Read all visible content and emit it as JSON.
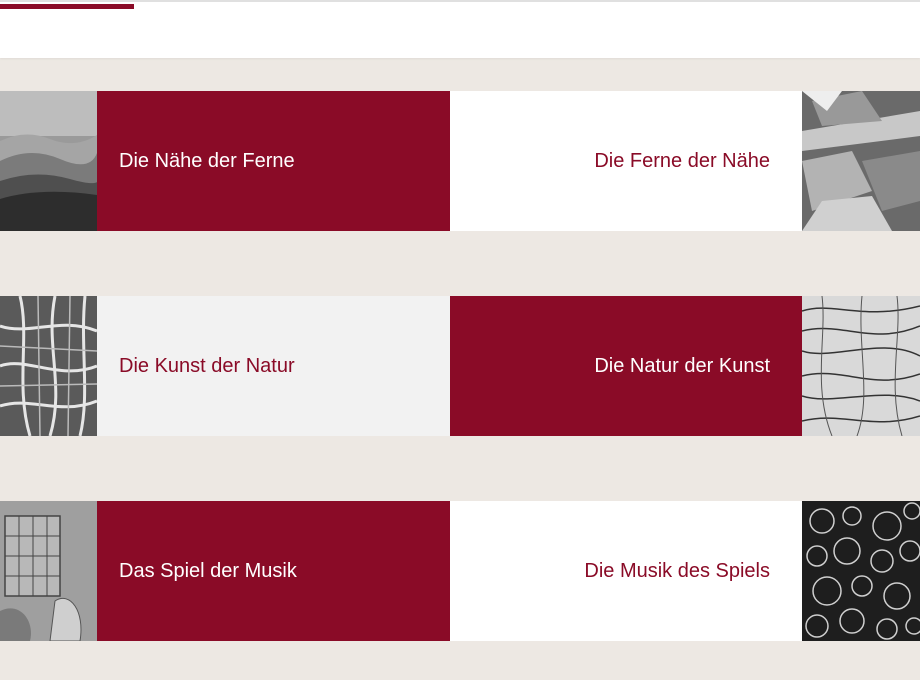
{
  "colors": {
    "accent": "#8a0b27",
    "background": "#ede8e3",
    "panel_light": "#ffffff",
    "panel_grey": "#f2f2f2"
  },
  "rows": [
    {
      "left": {
        "label": "Die Nähe der Ferne",
        "style": "red"
      },
      "right": {
        "label": "Die Ferne der Nähe",
        "style": "white"
      },
      "left_image": "misty-mountains-image",
      "right_image": "glass-texture-image"
    },
    {
      "left": {
        "label": "Die Kunst der Natur",
        "style": "grey"
      },
      "right": {
        "label": "Die Natur der Kunst",
        "style": "red"
      },
      "left_image": "leaf-veins-image",
      "right_image": "ink-lines-image"
    },
    {
      "left": {
        "label": "Das Spiel der Musik",
        "style": "red"
      },
      "right": {
        "label": "Die Musik des Spiels",
        "style": "white"
      },
      "left_image": "engraving-image",
      "right_image": "bubbles-image"
    }
  ]
}
